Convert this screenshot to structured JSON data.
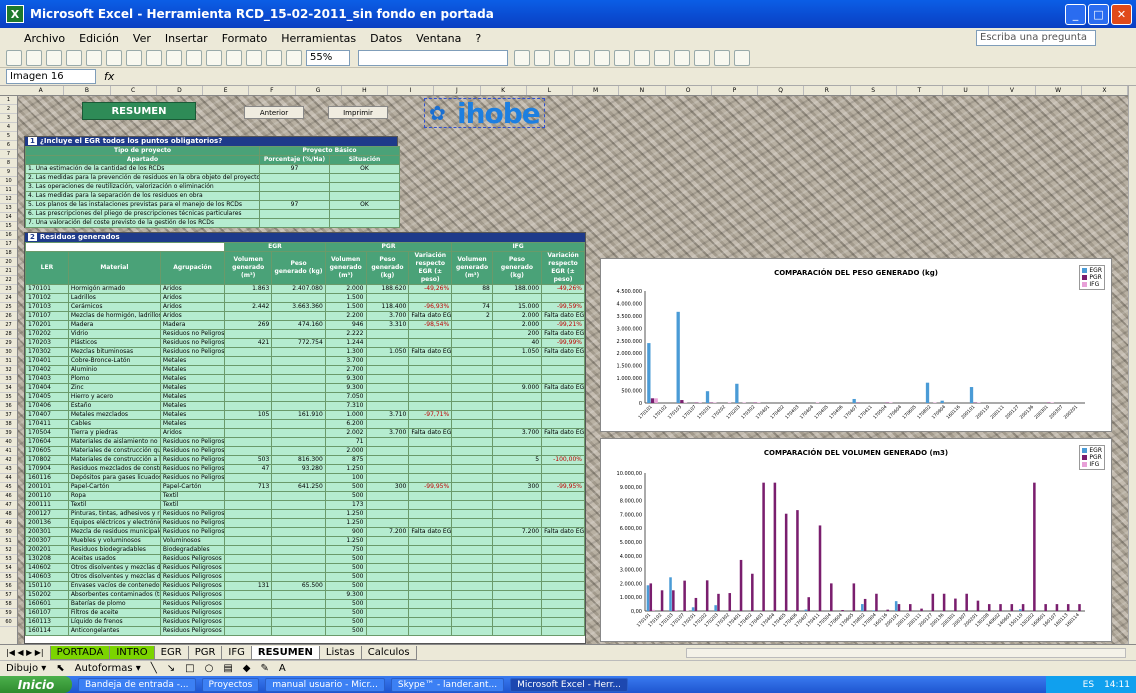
{
  "window": {
    "title": "Microsoft Excel - Herramienta RCD_15-02-2011_sin fondo en portada",
    "app_icon": "X"
  },
  "menu": {
    "items": [
      "Archivo",
      "Edición",
      "Ver",
      "Insertar",
      "Formato",
      "Herramientas",
      "Datos",
      "Ventana",
      "?"
    ],
    "ask": "Escriba una pregunta"
  },
  "toolbar": {
    "zoom": "55%"
  },
  "formula": {
    "namebox": "Imagen 16",
    "fx": "fx"
  },
  "columns": [
    "A",
    "B",
    "C",
    "D",
    "E",
    "F",
    "G",
    "H",
    "I",
    "J",
    "K",
    "L",
    "M",
    "N",
    "O",
    "P",
    "Q",
    "R",
    "S",
    "T",
    "U",
    "V",
    "W",
    "X"
  ],
  "rows": [
    "1",
    "2",
    "3",
    "4",
    "5",
    "6",
    "7",
    "8",
    "9",
    "10",
    "11",
    "12",
    "13",
    "14",
    "15",
    "16",
    "17",
    "18",
    "20",
    "21",
    "22",
    "23",
    "24",
    "25",
    "26",
    "27",
    "28",
    "29",
    "30",
    "31",
    "32",
    "33",
    "34",
    "35",
    "36",
    "37",
    "38",
    "39",
    "40",
    "41",
    "42",
    "43",
    "44",
    "45",
    "46",
    "47",
    "48",
    "49",
    "50",
    "51",
    "52",
    "53",
    "54",
    "55",
    "56",
    "57",
    "58",
    "59",
    "60"
  ],
  "sheet": {
    "resumen": "RESUMEN",
    "btn_prev": "Anterior",
    "btn_print": "Imprimir",
    "logo": "ihobe",
    "section1": {
      "num": "1",
      "title": "¿Incluye el EGR todos los puntos obligatorios?",
      "col_a": "Tipo de proyecto",
      "col_b": "Proyecto Básico",
      "apartado": "Apartado",
      "pct": "Porcentaje (%/Ha)",
      "sit": "Situación",
      "items": [
        [
          "1. Una estimación de la cantidad de los RCDs",
          "97",
          "OK"
        ],
        [
          "2. Las medidas para la prevención de residuos en la obra objeto del proyecto",
          "",
          ""
        ],
        [
          "3. Las operaciones de reutilización, valorización o eliminación",
          "",
          ""
        ],
        [
          "4. Las medidas para la separación de los residuos en obra",
          "",
          ""
        ],
        [
          "5. Los planos de las instalaciones previstas para el manejo de los RCDs",
          "97",
          "OK"
        ],
        [
          "6. Las prescripciones del pliego de prescripciones técnicas particulares",
          "",
          ""
        ],
        [
          "7. Una valoración del coste previsto de la gestión de los RCDs",
          "",
          ""
        ]
      ]
    },
    "section2": {
      "num": "2",
      "title": "Residuos generados",
      "groups": [
        "EGR",
        "PGR",
        "IFG"
      ],
      "headers": [
        "LER",
        "Material",
        "Agrupación",
        "Volumen generado (m³)",
        "Peso generado (kg)",
        "Volumen generado (m³)",
        "Peso generado (kg)",
        "Variación respecto EGR (± peso)",
        "Volumen generado (m³)",
        "Peso generado (kg)",
        "Variación respecto EGR (± peso)"
      ],
      "rows": [
        [
          "170101",
          "Hormigón armado",
          "Áridos",
          "1.863",
          "2.407.080",
          "2.000",
          "188.620",
          "-49,26%",
          "88",
          "188.000",
          "-49,26%"
        ],
        [
          "170102",
          "Ladrillos",
          "Áridos",
          "",
          "",
          "1.500",
          "",
          "",
          "",
          "",
          ""
        ],
        [
          "170103",
          "Cerámicos",
          "Áridos",
          "2.442",
          "3.663.360",
          "1.500",
          "118.400",
          "-96,93%",
          "74",
          "15.000",
          "-99,59%"
        ],
        [
          "170107",
          "Mezclas de hormigón, ladrillos, tejas y materiales cerámicos",
          "Áridos",
          "",
          "",
          "2.200",
          "3.700",
          "Falta dato EGR",
          "2",
          "2.000",
          "Falta dato EGR"
        ],
        [
          "170201",
          "Madera",
          "Madera",
          "269",
          "474.160",
          "946",
          "3.310",
          "-98,54%",
          "",
          "2.000",
          "-99,21%"
        ],
        [
          "170202",
          "Vidrio",
          "Residuos no Peligrosos",
          "",
          "",
          "2.222",
          "",
          "",
          "",
          "200",
          "Falta dato EGR"
        ],
        [
          "170203",
          "Plásticos",
          "Residuos no Peligrosos",
          "421",
          "772.754",
          "1.244",
          "",
          "",
          "",
          "40",
          "-99,99%"
        ],
        [
          "170302",
          "Mezclas bituminosas",
          "Residuos no Peligrosos",
          "",
          "",
          "1.300",
          "1.050",
          "Falta dato EGR",
          "",
          "1.050",
          "Falta dato EGR"
        ],
        [
          "170401",
          "Cobre-Bronce-Latón",
          "Metales",
          "",
          "",
          "3.700",
          "",
          "",
          "",
          "",
          ""
        ],
        [
          "170402",
          "Aluminio",
          "Metales",
          "",
          "",
          "2.700",
          "",
          "",
          "",
          "",
          ""
        ],
        [
          "170403",
          "Plomo",
          "Metales",
          "",
          "",
          "9.300",
          "",
          "",
          "",
          "",
          ""
        ],
        [
          "170404",
          "Zinc",
          "Metales",
          "",
          "",
          "9.300",
          "",
          "",
          "",
          "9.000",
          "Falta dato EGR"
        ],
        [
          "170405",
          "Hierro y acero",
          "Metales",
          "",
          "",
          "7.050",
          "",
          "",
          "",
          "",
          ""
        ],
        [
          "170406",
          "Estaño",
          "Metales",
          "",
          "",
          "7.310",
          "",
          "",
          "",
          "",
          ""
        ],
        [
          "170407",
          "Metales mezclados",
          "Metales",
          "105",
          "161.910",
          "1.000",
          "3.710",
          "-97,71%",
          "",
          "",
          ""
        ],
        [
          "170411",
          "Cables",
          "Metales",
          "",
          "",
          "6.200",
          "",
          "",
          "",
          "",
          ""
        ],
        [
          "170504",
          "Tierra y piedras",
          "Áridos",
          "",
          "",
          "2.002",
          "3.700",
          "Falta dato EGR",
          "",
          "3.700",
          "Falta dato EGR"
        ],
        [
          "170604",
          "Materiales de aislamiento no peligrosos",
          "Residuos no Peligrosos",
          "",
          "",
          "71",
          "",
          "",
          "",
          "",
          ""
        ],
        [
          "170605",
          "Materiales de construcción que contienen amianto",
          "Residuos no Peligrosos",
          "",
          "",
          "2.000",
          "",
          "",
          "",
          "",
          ""
        ],
        [
          "170802",
          "Materiales de construcción a base de yeso",
          "Residuos no Peligrosos",
          "503",
          "816.300",
          "875",
          "",
          "",
          "",
          "5",
          "-100,00%"
        ],
        [
          "170904",
          "Residuos mezclados de construcción y demolición",
          "Residuos no Peligrosos",
          "47",
          "93.280",
          "1.250",
          "",
          "",
          "",
          "",
          ""
        ],
        [
          "160116",
          "Depósitos para gases licuados",
          "Residuos no Peligrosos",
          "",
          "",
          "100",
          "",
          "",
          "",
          "",
          ""
        ],
        [
          "200101",
          "Papel-Cartón",
          "Papel-Cartón",
          "713",
          "641.250",
          "500",
          "300",
          "-99,95%",
          "",
          "300",
          "-99,95%"
        ],
        [
          "200110",
          "Ropa",
          "Textil",
          "",
          "",
          "500",
          "",
          "",
          "",
          "",
          ""
        ],
        [
          "200111",
          "Textil",
          "Textil",
          "",
          "",
          "173",
          "",
          "",
          "",
          "",
          ""
        ],
        [
          "200127",
          "Pinturas, tintas, adhesivos y resinas (sin pictograma de peligro)",
          "Residuos no Peligrosos",
          "",
          "",
          "1.250",
          "",
          "",
          "",
          "",
          ""
        ],
        [
          "200136",
          "Equipos eléctricos y electrónicos desechados no peligrosos",
          "Residuos no Peligrosos",
          "",
          "",
          "1.250",
          "",
          "",
          "",
          "",
          ""
        ],
        [
          "200301",
          "Mezcla de residuos municipales",
          "Residuos no Peligrosos",
          "",
          "",
          "900",
          "7.200",
          "Falta dato EGR",
          "",
          "7.200",
          "Falta dato EGR"
        ],
        [
          "200307",
          "Muebles y voluminosos",
          "Voluminosos",
          "",
          "",
          "1.250",
          "",
          "",
          "",
          "",
          ""
        ],
        [
          "200201",
          "Residuos biodegradables",
          "Biodegradables",
          "",
          "",
          "750",
          "",
          "",
          "",
          "",
          ""
        ],
        [
          "130208",
          "Aceites usados",
          "Residuos Peligrosos",
          "",
          "",
          "500",
          "",
          "",
          "",
          "",
          ""
        ],
        [
          "140602",
          "Otros disolventes y mezclas de disolventes halogenados",
          "Residuos Peligrosos",
          "",
          "",
          "500",
          "",
          "",
          "",
          "",
          ""
        ],
        [
          "140603",
          "Otros disolventes y mezclas de disolventes no halogenados",
          "Residuos Peligrosos",
          "",
          "",
          "500",
          "",
          "",
          "",
          "",
          ""
        ],
        [
          "150110",
          "Envases vacíos de contenedor peligrosos",
          "Residuos Peligrosos",
          "131",
          "65.500",
          "500",
          "",
          "",
          "",
          "",
          ""
        ],
        [
          "150202",
          "Absorbentes contaminados (trapos, etc.)",
          "Residuos Peligrosos",
          "",
          "",
          "9.300",
          "",
          "",
          "",
          "",
          ""
        ],
        [
          "160601",
          "Baterías de plomo",
          "Residuos Peligrosos",
          "",
          "",
          "500",
          "",
          "",
          "",
          "",
          ""
        ],
        [
          "160107",
          "Filtros de aceite",
          "Residuos Peligrosos",
          "",
          "",
          "500",
          "",
          "",
          "",
          "",
          ""
        ],
        [
          "160113",
          "Líquido de frenos",
          "Residuos Peligrosos",
          "",
          "",
          "500",
          "",
          "",
          "",
          "",
          ""
        ],
        [
          "160114",
          "Anticongelantes",
          "Residuos Peligrosos",
          "",
          "",
          "500",
          "",
          "",
          "",
          "",
          ""
        ]
      ]
    }
  },
  "chart_data": [
    {
      "type": "bar",
      "title": "COMPARACIÓN DEL PESO GENERADO (kg)",
      "ylim": [
        0,
        4500000
      ],
      "yticks": [
        "4.500.000",
        "4.000.000",
        "3.500.000",
        "3.000.000",
        "2.500.000",
        "2.000.000",
        "1.500.000",
        "1.000.000",
        "500.000",
        "0"
      ],
      "categories": [
        "170101",
        "170102",
        "170103",
        "170107",
        "170201",
        "170202",
        "170203",
        "170302",
        "170401",
        "170402",
        "170403",
        "170404",
        "170405",
        "170406",
        "170407",
        "170411",
        "170504",
        "170604",
        "170605",
        "170802",
        "170904",
        "160116",
        "200101",
        "200110",
        "200111",
        "200127",
        "200136",
        "200301",
        "200307",
        "200201"
      ],
      "series": [
        {
          "name": "EGR",
          "color": "#4a9bd6",
          "values": [
            2407080,
            0,
            3663360,
            0,
            474160,
            0,
            772754,
            0,
            0,
            0,
            0,
            0,
            0,
            0,
            161910,
            0,
            0,
            0,
            0,
            816300,
            93280,
            0,
            641250,
            0,
            0,
            0,
            0,
            0,
            0,
            0
          ]
        },
        {
          "name": "PGR",
          "color": "#7a1e6e",
          "values": [
            188620,
            0,
            118400,
            3700,
            3310,
            0,
            0,
            1050,
            0,
            0,
            0,
            0,
            0,
            0,
            3710,
            0,
            3700,
            0,
            0,
            0,
            0,
            0,
            300,
            0,
            0,
            0,
            0,
            7200,
            0,
            0
          ]
        },
        {
          "name": "IFG",
          "color": "#e8a0d8",
          "values": [
            188000,
            0,
            15000,
            2000,
            2000,
            200,
            40,
            1050,
            0,
            0,
            0,
            9000,
            0,
            0,
            0,
            0,
            3700,
            0,
            0,
            5,
            0,
            0,
            300,
            0,
            0,
            0,
            0,
            7200,
            0,
            0
          ]
        }
      ]
    },
    {
      "type": "bar",
      "title": "COMPARACIÓN DEL VOLUMEN GENERADO (m3)",
      "ylim": [
        0,
        10000
      ],
      "yticks": [
        "10.000,00",
        "9.000,00",
        "8.000,00",
        "7.000,00",
        "6.000,00",
        "5.000,00",
        "4.000,00",
        "3.000,00",
        "2.000,00",
        "1.000,00",
        "0,00"
      ],
      "categories": [
        "170101",
        "170102",
        "170103",
        "170107",
        "170201",
        "170202",
        "170203",
        "170302",
        "170401",
        "170402",
        "170403",
        "170404",
        "170405",
        "170406",
        "170407",
        "170411",
        "170504",
        "170604",
        "170605",
        "170802",
        "170904",
        "160116",
        "200101",
        "200110",
        "200111",
        "200127",
        "200136",
        "200301",
        "200307",
        "200201",
        "130208",
        "140602",
        "140603",
        "150110",
        "150202",
        "160601",
        "160107",
        "160113",
        "160114"
      ],
      "series": [
        {
          "name": "EGR",
          "color": "#4a9bd6",
          "values": [
            1863,
            0,
            2442,
            0,
            269,
            0,
            421,
            0,
            0,
            0,
            0,
            0,
            0,
            0,
            105,
            0,
            0,
            0,
            0,
            503,
            47,
            0,
            713,
            0,
            0,
            0,
            0,
            0,
            0,
            0,
            0,
            0,
            0,
            131,
            0,
            0,
            0,
            0,
            0
          ]
        },
        {
          "name": "PGR",
          "color": "#7a1e6e",
          "values": [
            2000,
            1500,
            1500,
            2200,
            946,
            2222,
            1244,
            1300,
            3700,
            2700,
            9300,
            9300,
            7050,
            7310,
            1000,
            6200,
            2002,
            71,
            2000,
            875,
            1250,
            100,
            500,
            500,
            173,
            1250,
            1250,
            900,
            1250,
            750,
            500,
            500,
            500,
            500,
            9300,
            500,
            500,
            500,
            500
          ]
        },
        {
          "name": "IFG",
          "color": "#e8a0d8",
          "values": [
            88,
            0,
            74,
            2,
            0,
            0,
            0,
            0,
            0,
            0,
            0,
            0,
            0,
            0,
            0,
            0,
            0,
            0,
            0,
            0,
            0,
            0,
            0,
            0,
            0,
            0,
            0,
            0,
            0,
            0,
            0,
            0,
            0,
            0,
            0,
            0,
            0,
            0,
            0
          ]
        }
      ]
    }
  ],
  "tabs": [
    "PORTADA",
    "INTRO",
    "EGR",
    "PGR",
    "IFG",
    "RESUMEN",
    "Listas",
    "Calculos"
  ],
  "drawbar": {
    "dibujo": "Dibujo ▾",
    "autoformas": "Autoformas ▾"
  },
  "taskbar": {
    "start": "Inicio",
    "tasks": [
      "Bandeja de entrada -...",
      "Proyectos",
      "manual usuario - Micr...",
      "Skype™ - lander.ant...",
      "Microsoft Excel - Herr..."
    ],
    "lang": "ES",
    "time": "14:11"
  }
}
